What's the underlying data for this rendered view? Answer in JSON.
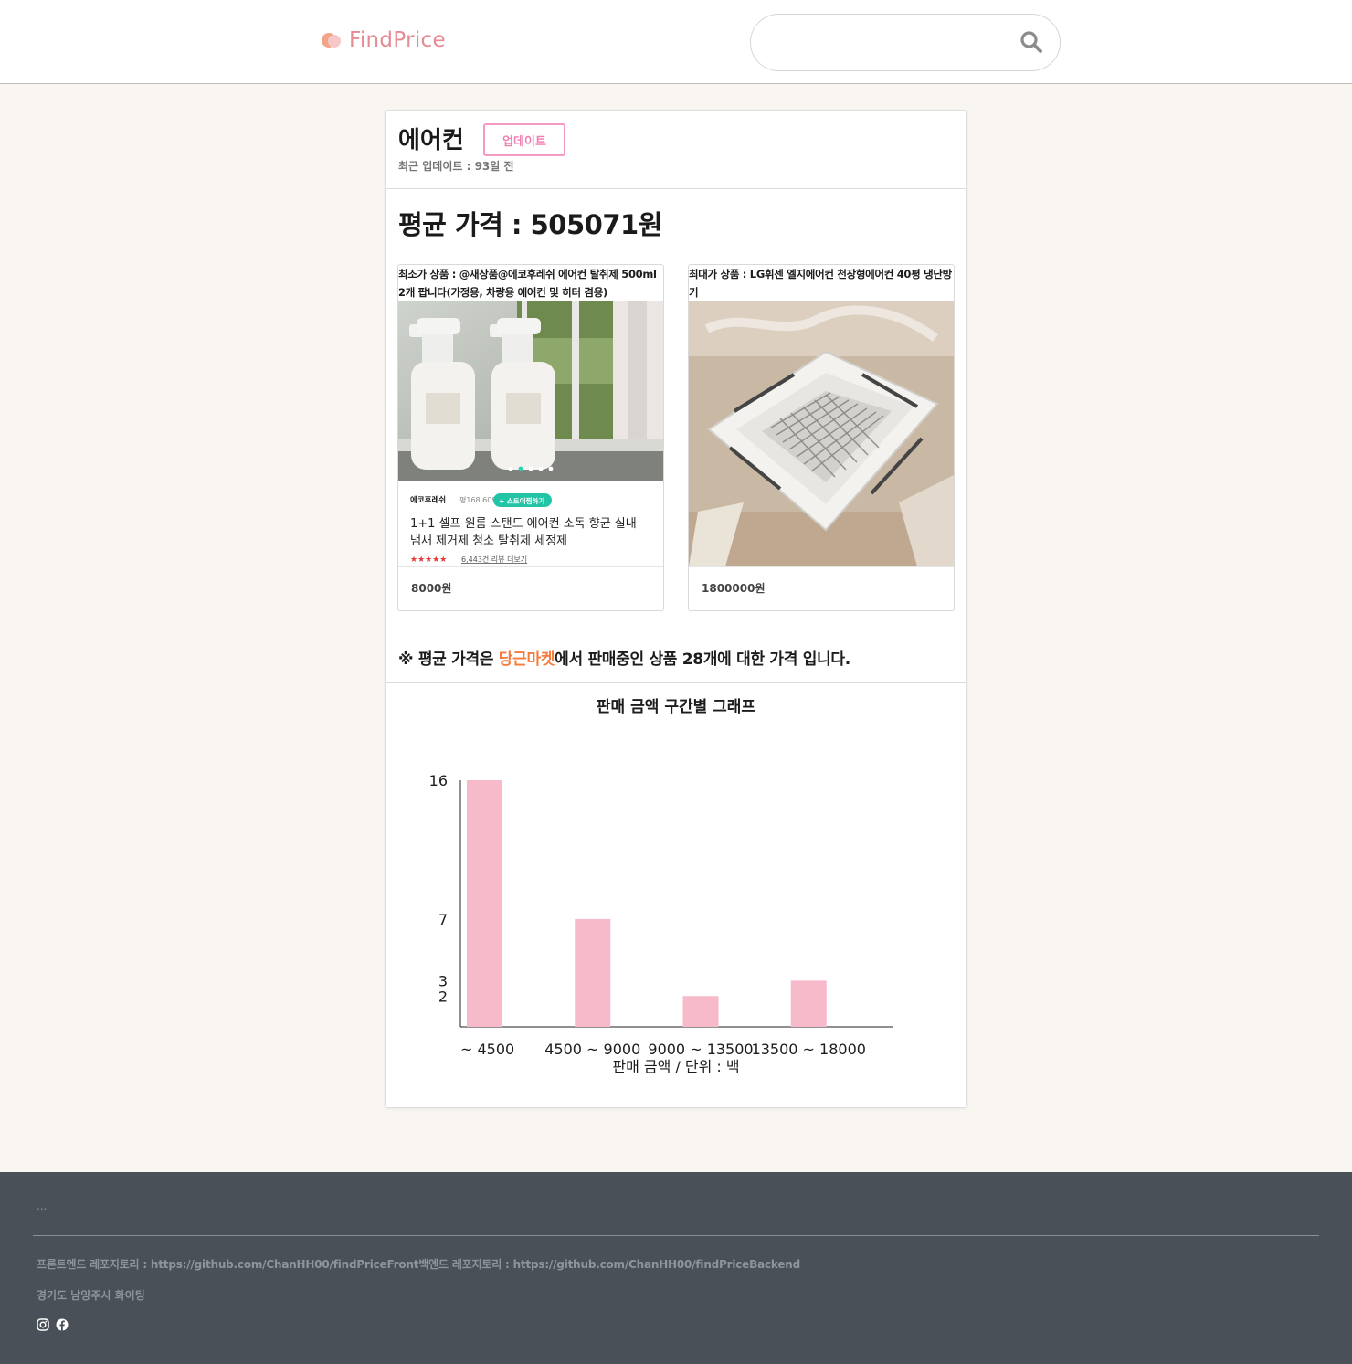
{
  "header": {
    "logo_text": "FindPrice",
    "search_placeholder": ""
  },
  "item": {
    "title": "에어컨",
    "update_button": "업데이트",
    "last_updated": "최근 업데이트 : 93일 전",
    "average_price": "평균 가격 : 505071원"
  },
  "products": {
    "min": {
      "label": "최소가 상품 : @새상품@에코후레쉬 에어컨 탈취제 500ml 2개 팝니다(가정용, 차량용 에어컨 및 히터 겸용)",
      "price": "8000원",
      "img": {
        "brand": "에코후레쉬",
        "rating_text": "평168,609",
        "store_button": "+ 스토어찜하기",
        "desc_line1": "1+1 셀프 원룸 스탠드 에어컨 소독 향균 실내",
        "desc_line2": "냄새 제거제 청소 탈취제 세정제",
        "reviews": "6,443건 리뷰 더보기"
      }
    },
    "max": {
      "label": "최대가 상품 : LG휘센 엘지에어컨 천장형에어컨 40평 냉난방기",
      "price": "1800000원"
    }
  },
  "notice": {
    "prefix": "※ 평균 가격은 ",
    "accent": "당근마켓",
    "suffix": "에서 판매중인 상품 28개에 대한 가격 입니다."
  },
  "chart_data": {
    "type": "bar",
    "title": "판매 금액 구간별 그래프",
    "categories": [
      "~ 4500",
      "4500 ~ 9000",
      "9000 ~ 13500",
      "13500 ~ 18000"
    ],
    "values": [
      16,
      7,
      2,
      3
    ],
    "yticks": [
      16,
      7,
      3,
      2
    ],
    "xlabel": "판매 금액 / 단위 : 백",
    "ylim": [
      0,
      16
    ],
    "bar_color": "#f7bacb"
  },
  "footer": {
    "dots": "...",
    "repos": "프론트엔드 레포지토리 : https://github.com/ChanHH00/findPriceFront백엔드 레포지토리 : https://github.com/ChanHH00/findPriceBackend",
    "address": "경기도 남양주시 화이팅"
  },
  "colors": {
    "accent_pink": "#f27db2",
    "accent_orange": "#f47c3c",
    "footer_bg": "#495057"
  }
}
